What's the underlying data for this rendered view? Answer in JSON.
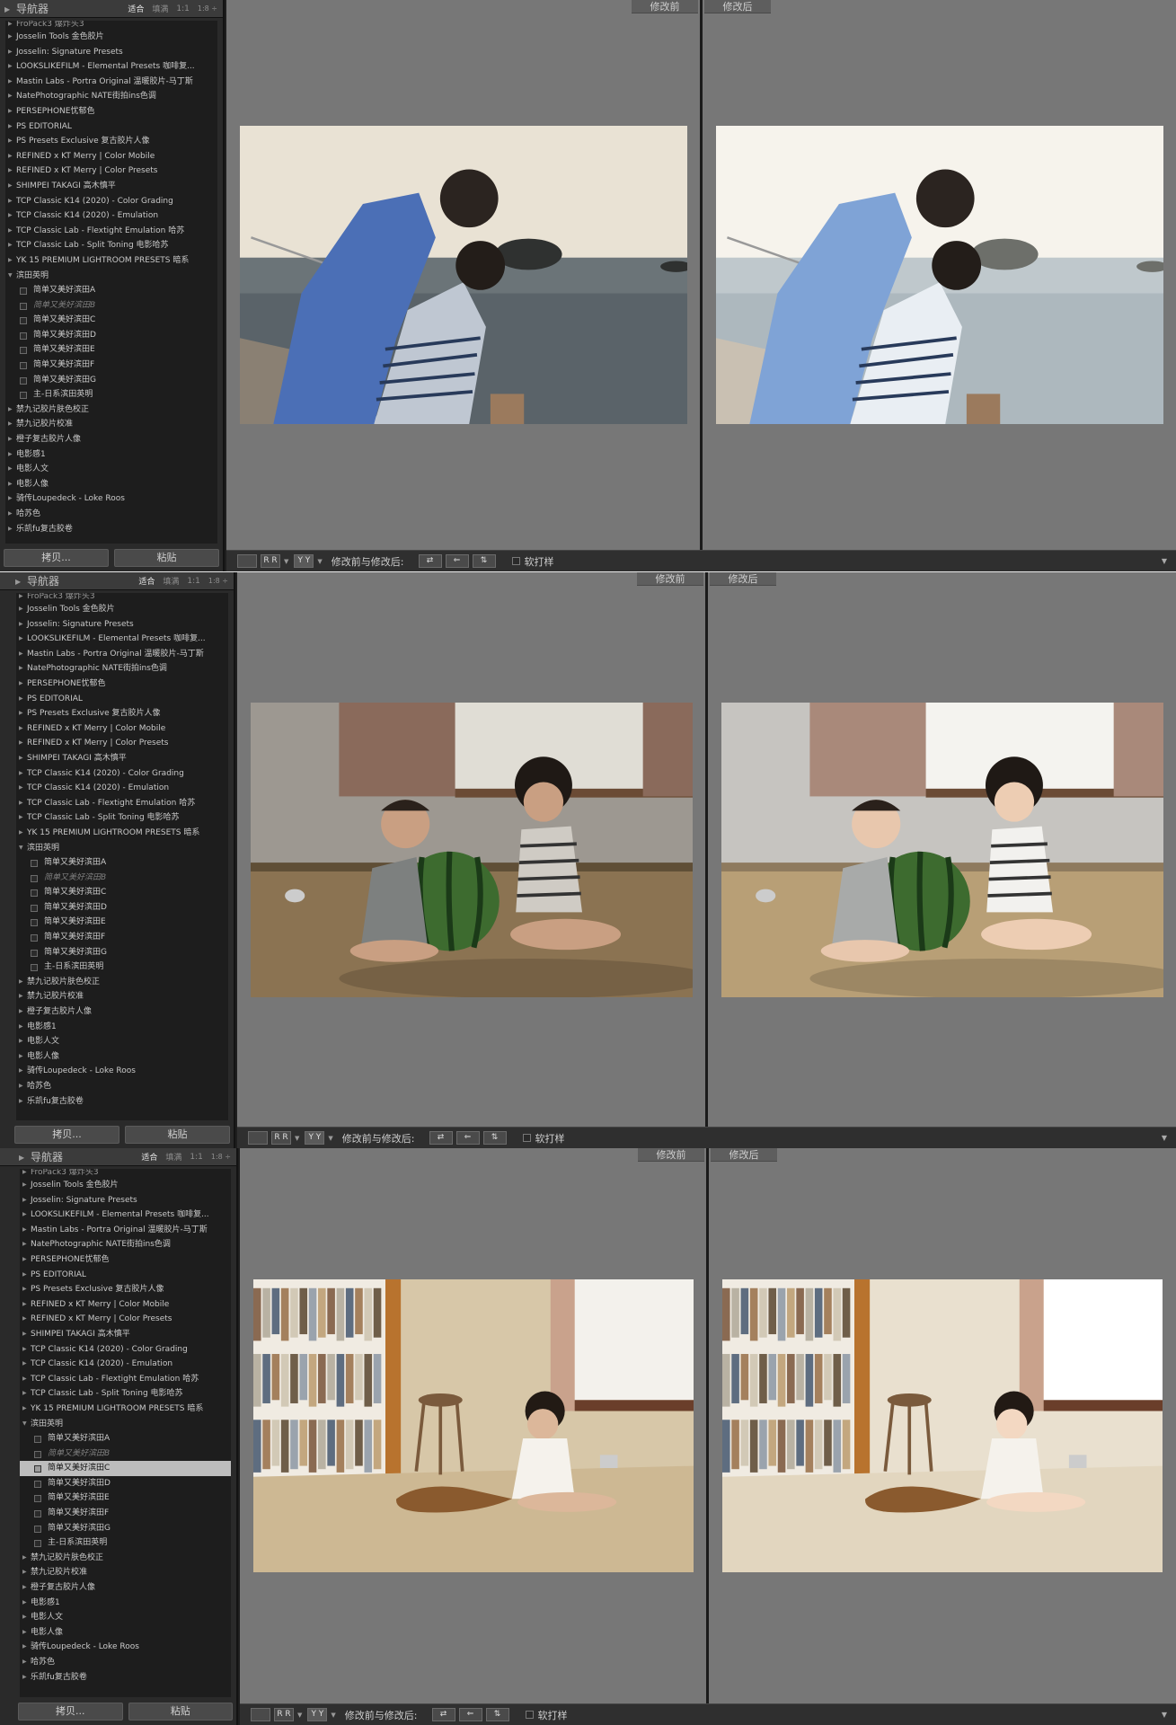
{
  "nav": {
    "title": "导航器",
    "zoom_fit": "适合",
    "zoom_fill": "填满",
    "zoom_1_1": "1:1",
    "zoom_1_8": "1:8 ÷"
  },
  "presets": {
    "top_partial": "FroPack3  爆炸头3",
    "folders_before": [
      "Josselin Tools 金色胶片",
      "Josselin: Signature Presets",
      "LOOKSLIKEFILM - Elemental Presets 咖啡复...",
      "Mastin Labs - Portra Original 温暖胶片-马丁斯",
      "NatePhotographic NATE街拍ins色调",
      "PERSEPHONE忧郁色",
      "PS EDITORIAL",
      "PS Presets Exclusive 复古胶片人像",
      "REFINED x KT Merry | Color Mobile",
      "REFINED x KT Merry | Color Presets",
      "SHIMPEI TAKAGI 高木慎平",
      "TCP Classic K14 (2020) - Color Grading",
      "TCP Classic K14 (2020) - Emulation",
      "TCP Classic Lab - Flextight Emulation 哈苏",
      "TCP Classic Lab - Split Toning 电影哈苏",
      "YK 15 PREMIUM LIGHTROOM PRESETS 暗系"
    ],
    "open_folder": "滨田英明",
    "sub_items": [
      "简单又美好滨田A",
      "简单又美好滨田B",
      "简单又美好滨田C",
      "简单又美好滨田D",
      "简单又美好滨田E",
      "简单又美好滨田F",
      "简单又美好滨田G",
      "主-日系滨田英明"
    ],
    "folders_after": [
      "禁九记胶片肤色校正",
      "禁九记胶片校准",
      "橙子复古胶片人像",
      "电影感1",
      "电影人文",
      "电影人像",
      "骑传Loupedeck - Loke Roos",
      "哈苏色",
      "乐凯fu复古胶卷"
    ]
  },
  "buttons": {
    "copy": "拷贝...",
    "paste": "粘贴"
  },
  "compare": {
    "before": "修改前",
    "after": "修改后"
  },
  "toolbar": {
    "view_single": "",
    "view_rr": "R R",
    "view_yy": "Y Y",
    "mode_label": "修改前与修改后:",
    "soft_proof": "软打样",
    "icon_swap": "swap-icon",
    "icon_copy": "copy-settings-icon",
    "icon_split": "split-icon"
  },
  "panels": [
    {
      "selected_index": -1
    },
    {
      "selected_index": -1
    },
    {
      "selected_index": 2
    }
  ],
  "colors": {
    "panel_bg": "#2a2a2a",
    "list_bg": "#1d1d1d",
    "canvas_bg": "#777777",
    "selected_row": "#bdbdbd"
  }
}
